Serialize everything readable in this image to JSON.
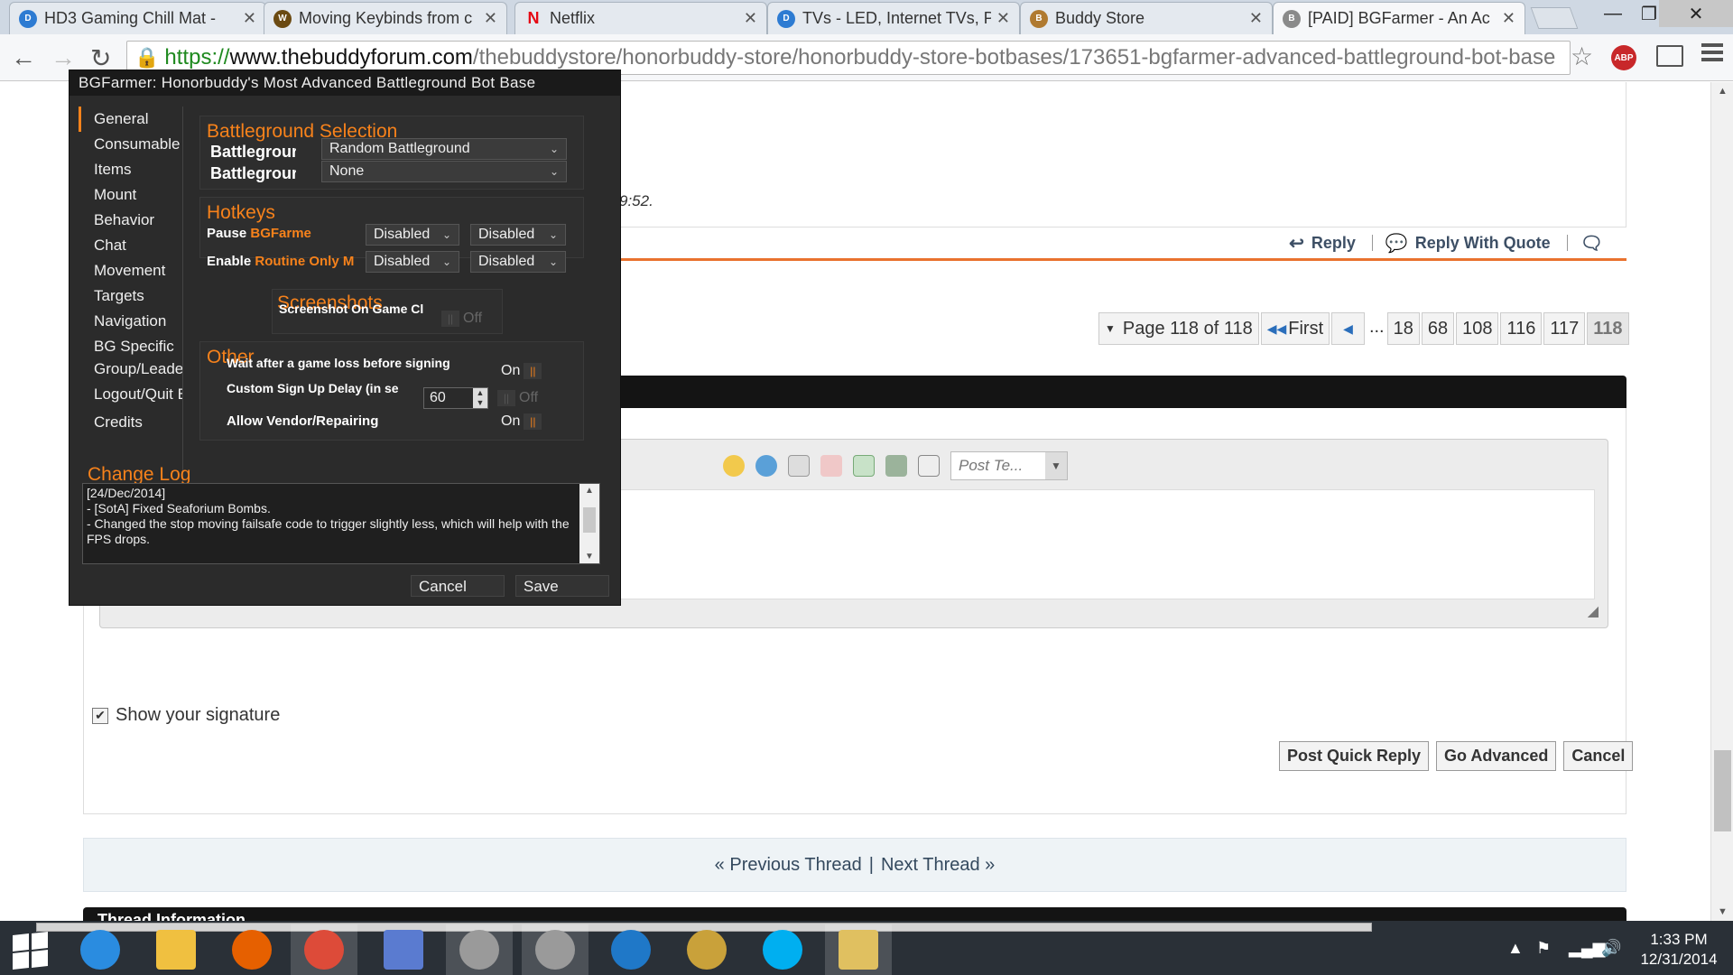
{
  "tabs": [
    {
      "title": "HD3 Gaming Chill Mat -",
      "favicon": "dell-icon",
      "color": "#2d7bd2"
    },
    {
      "title": "Moving Keybinds from c",
      "favicon": "warcraft-icon",
      "color": "#6b4a12"
    },
    {
      "title": "Netflix",
      "favicon": "netflix-icon",
      "color": "#e50914"
    },
    {
      "title": "TVs - LED, Internet TVs, P",
      "favicon": "dell-icon",
      "color": "#2d7bd2"
    },
    {
      "title": "Buddy Store",
      "favicon": "buddy-icon",
      "color": "#b07a30"
    },
    {
      "title": "[PAID] BGFarmer - An Ac",
      "favicon": "buddy-icon",
      "color": "#8a8a8a"
    }
  ],
  "address": {
    "scheme": "https://",
    "domain": "www.thebuddyforum.com",
    "path": "/thebuddystore/honorbuddy-store/honorbuddy-store-botbases/173651-bgfarmer-advanced-battleground-bot-base"
  },
  "abp_badge": "ABP",
  "post": {
    "time": "9:52.",
    "actions": [
      "Reply",
      "Reply With Quote"
    ]
  },
  "pagenav": {
    "label": "Page 118 of 118",
    "first": "First",
    "dots": "...",
    "pages": [
      "18",
      "68",
      "108",
      "116",
      "117",
      "118"
    ],
    "current": "118"
  },
  "editor": {
    "post_type": "Post Te..."
  },
  "signature": {
    "label": "Show your signature",
    "checked": true
  },
  "form_buttons": [
    "Post Quick Reply",
    "Go Advanced",
    "Cancel"
  ],
  "threadnav": {
    "prev": "« Previous Thread",
    "sep": "|",
    "next": "Next Thread »"
  },
  "thread_info": "Thread Information",
  "dialog": {
    "title": "BGFarmer: Honorbuddy's Most Advanced Battleground Bot Base",
    "nav": [
      "General",
      "Consumable",
      "Items",
      "Mount",
      "Behavior",
      "Chat",
      "Movement",
      "Targets",
      "Navigation",
      "BG Specific",
      "Group/Leader",
      "Logout/Quit BG",
      "Credits"
    ],
    "battleground": {
      "title": "Battleground Selection",
      "row1_label": "Battlegrour",
      "row1_value": "Random Battleground",
      "row2_label": "Battlegrour",
      "row2_value": "None"
    },
    "hotkeys": {
      "title": "Hotkeys",
      "pause_label": "Pause ",
      "pause_hl": "BGFarme",
      "enable_label": "Enable ",
      "enable_hl": "Routine Only M",
      "value": "Disabled"
    },
    "screenshots": {
      "title": "Screenshots",
      "label": "Screenshot On Game Cl",
      "toggle": "Off"
    },
    "other": {
      "title": "Other",
      "wait_label": "Wait after a game loss before signing",
      "wait_toggle": "On",
      "delay_label": "Custom Sign Up Delay (in se",
      "delay_value": "60",
      "delay_toggle": "Off",
      "vendor_label": "Allow Vendor/Repairing",
      "vendor_toggle": "On"
    },
    "changelog": {
      "title": "Change Log",
      "text": "[24/Dec/2014]\n- [SotA] Fixed Seaforium Bombs.\n- Changed the stop moving failsafe code to trigger slightly less, which will help with the FPS drops."
    },
    "cancel": "Cancel",
    "save": "Save"
  },
  "taskbar": {
    "items": [
      {
        "name": "internet-explorer-icon",
        "color": "#2a8ce0"
      },
      {
        "name": "file-explorer-icon",
        "color": "#f0c040"
      },
      {
        "name": "firefox-icon",
        "color": "#e66000"
      },
      {
        "name": "chrome-icon",
        "color": "#dd4b39"
      },
      {
        "name": "network-tool-icon",
        "color": "#5a7bd0"
      },
      {
        "name": "honorbuddy-icon",
        "color": "#9a9a9a"
      },
      {
        "name": "honorbuddy-icon-2",
        "color": "#9a9a9a"
      },
      {
        "name": "clock-app-icon",
        "color": "#1f78c8"
      },
      {
        "name": "warcraft-icon",
        "color": "#c9a13a"
      },
      {
        "name": "skype-icon",
        "color": "#00aff0"
      },
      {
        "name": "construction-app-icon",
        "color": "#e0c060"
      }
    ],
    "time": "1:33 PM",
    "date": "12/31/2014"
  },
  "colors": {
    "accent": "#f7821b",
    "link": "#3d4f65"
  }
}
